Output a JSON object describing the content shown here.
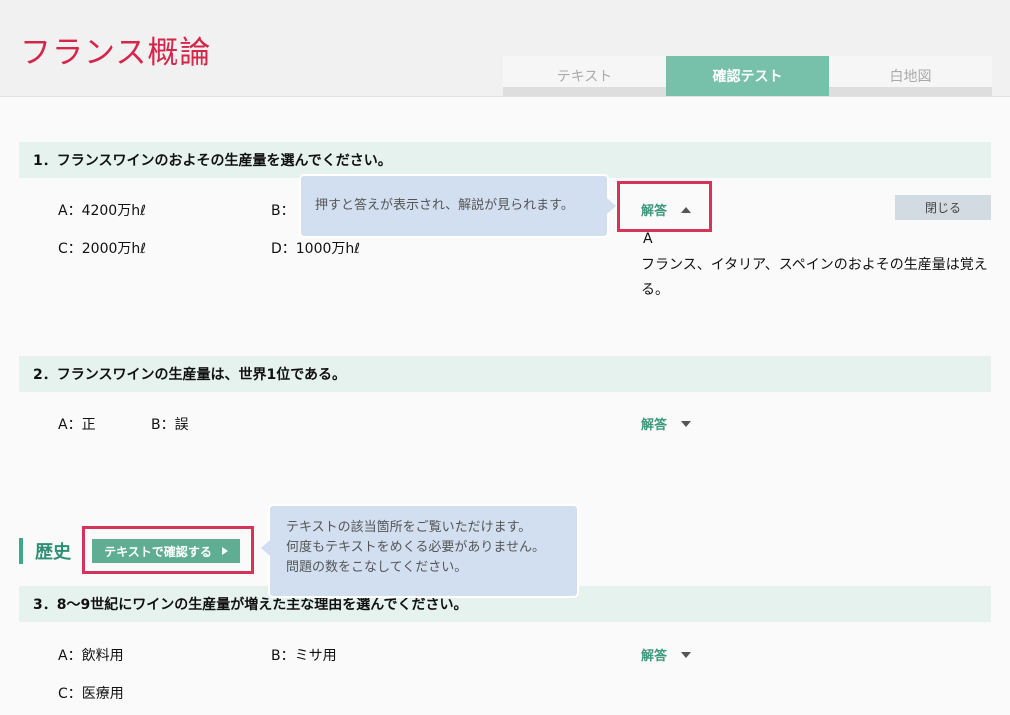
{
  "header": {
    "title": "フランス概論",
    "tabs": [
      {
        "label": "テキスト",
        "active": false
      },
      {
        "label": "確認テスト",
        "active": true
      },
      {
        "label": "白地図",
        "active": false
      }
    ]
  },
  "q1": {
    "title": "1．フランスワインのおよその生産量を選んでください。",
    "options": [
      "A：4200万hℓ",
      "B：",
      "C：2000万hℓ",
      "D：1000万hℓ"
    ],
    "answer_label": "解答",
    "close_label": "閉じる",
    "answer_letter": "A",
    "explanation": "フランス、イタリア、スペインのおよその生産量は覚える。"
  },
  "tooltip1": "押すと答えが表示され、解説が見られます。",
  "q2": {
    "title": "2．フランスワインの生産量は、世界1位である。",
    "options": [
      "A：正",
      "B：誤"
    ],
    "answer_label": "解答"
  },
  "section": {
    "title": "歴史",
    "button_label": "テキストで確認する"
  },
  "tooltip2": {
    "line1": "テキストの該当箇所をご覧いただけます。",
    "line2": "何度もテキストをめくる必要がありません。",
    "line3": "問題の数をこなしてください。"
  },
  "q3": {
    "title": "3．8〜9世紀にワインの生産量が増えた主な理由を選んでください。",
    "options": [
      "A：飲料用",
      "B：ミサ用",
      "C：医療用"
    ],
    "answer_label": "解答"
  }
}
